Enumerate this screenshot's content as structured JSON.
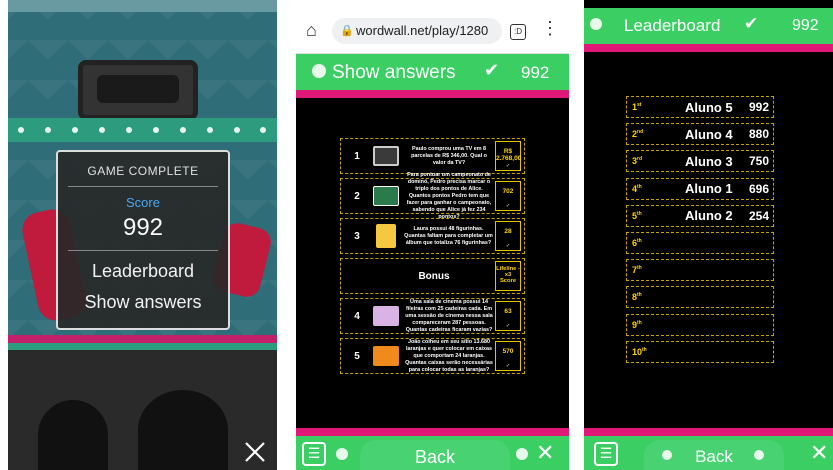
{
  "game_complete": {
    "title": "GAME COMPLETE",
    "score_label": "Score",
    "score_value": "992",
    "leaderboard_label": "Leaderboard",
    "show_answers_label": "Show answers"
  },
  "browser": {
    "url": "wordwall.net/play/1280",
    "tab_count": ":D"
  },
  "answers": {
    "header_title": "Show answers",
    "header_score": "992",
    "back_label": "Back",
    "rows": [
      {
        "num": "1",
        "question": "Paulo comprou uma TV em 8 parcelas de R$ 346,00. Qual o valor da TV?",
        "answer": "R$ 2.768,00"
      },
      {
        "num": "2",
        "question": "Para pontuar um campeonato de dominó, Pedro precisa marcar o triplo dos pontos de Alice. Quantos pontos Pedro tem que fazer para ganhar o campeonato, sabendo que Alice já fez 234 pontos?",
        "answer": "702"
      },
      {
        "num": "3",
        "question": "Laura possui 48 figurinhas. Quantas faltam para completar um álbum que totaliza 76 figurinhas?",
        "answer": "28"
      },
      {
        "num": "",
        "question": "Bonus",
        "answer": "Lifeline - x3 Score"
      },
      {
        "num": "4",
        "question": "Uma sala de cinema possui 14 fileiras com 25 cadeiras cada. Em uma sessão de cinema nessa sala compareceram 287 pessoas. Quantas cadeiras ficaram vazias?",
        "answer": "63"
      },
      {
        "num": "5",
        "question": "João colheu em seu sítio 13.680 laranjas e quer colocar em caixas que comportam 24 laranjas. Quantas caixas serão necessárias para colocar todas as laranjas?",
        "answer": "570"
      }
    ]
  },
  "leaderboard": {
    "header_title": "Leaderboard",
    "header_score": "992",
    "back_label": "Back",
    "rows": [
      {
        "rank": "1",
        "suffix": "st",
        "name": "Aluno 5",
        "score": "992"
      },
      {
        "rank": "2",
        "suffix": "nd",
        "name": "Aluno 4",
        "score": "880"
      },
      {
        "rank": "3",
        "suffix": "rd",
        "name": "Aluno 3",
        "score": "750"
      },
      {
        "rank": "4",
        "suffix": "th",
        "name": "Aluno 1",
        "score": "696"
      },
      {
        "rank": "5",
        "suffix": "th",
        "name": "Aluno 2",
        "score": "254"
      },
      {
        "rank": "6",
        "suffix": "th",
        "name": "",
        "score": ""
      },
      {
        "rank": "7",
        "suffix": "th",
        "name": "",
        "score": ""
      },
      {
        "rank": "8",
        "suffix": "th",
        "name": "",
        "score": ""
      },
      {
        "rank": "9",
        "suffix": "th",
        "name": "",
        "score": ""
      },
      {
        "rank": "10",
        "suffix": "th",
        "name": "",
        "score": ""
      }
    ]
  },
  "colors": {
    "green": "#3bcf63",
    "pink": "#e01978",
    "gold": "#ffd400",
    "score_blue": "#4aa8f0"
  }
}
